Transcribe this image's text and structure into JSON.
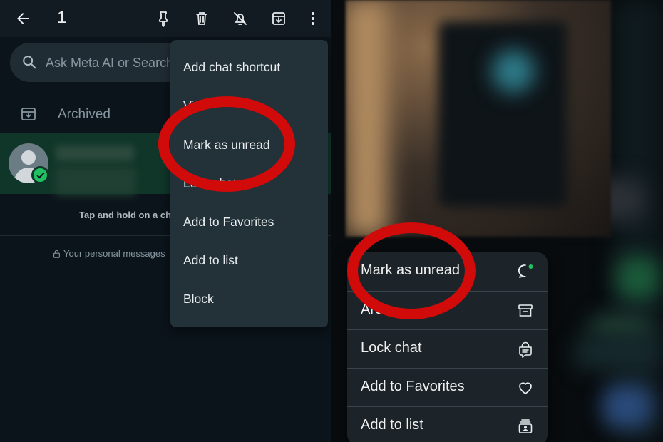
{
  "left": {
    "topbar": {
      "selected_count": "1"
    },
    "search": {
      "placeholder": "Ask Meta AI or Search"
    },
    "archived": {
      "label": "Archived"
    },
    "tip": "Tap and hold on a cha",
    "privacy": "Your personal messages",
    "menu": {
      "items": [
        "Add chat shortcut",
        "Vi",
        "Mark as unread",
        "Lock chat",
        "Add to Favorites",
        "Add to list",
        "Block"
      ]
    }
  },
  "right": {
    "menu": {
      "items": [
        {
          "label": "Mark as unread",
          "icon": "unread-chat-icon"
        },
        {
          "label": "Arc",
          "icon": "archive-icon"
        },
        {
          "label": "Lock chat",
          "icon": "lock-chat-icon"
        },
        {
          "label": "Add to Favorites",
          "icon": "heart-icon"
        },
        {
          "label": "Add to list",
          "icon": "list-icon"
        }
      ]
    }
  },
  "colors": {
    "annotation_red": "#d10a0a",
    "selected_row": "#103629",
    "accent_green": "#21c063"
  }
}
